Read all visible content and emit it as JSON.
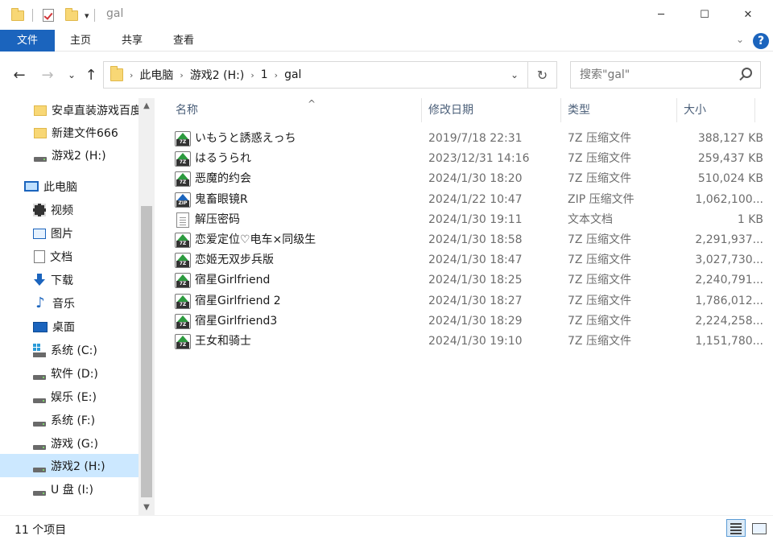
{
  "window": {
    "title": "gal",
    "minimize": "─",
    "maximize": "☐",
    "close": "✕"
  },
  "ribbon": {
    "tabs": [
      "文件",
      "主页",
      "共享",
      "查看"
    ],
    "help": "?",
    "collapse": "⌄"
  },
  "address": {
    "crumbs": [
      "此电脑",
      "游戏2 (H:)",
      "1",
      "gal"
    ],
    "separator": "›",
    "dropdown": "⌄",
    "refresh": "↻"
  },
  "nav_buttons": {
    "back": "←",
    "forward": "→",
    "recent": "⌄",
    "up": "↑"
  },
  "search": {
    "placeholder": "搜索\"gal\""
  },
  "nav_pane": {
    "items": [
      {
        "label": "安卓直装游戏百度",
        "icon": "folder-icon"
      },
      {
        "label": "新建文件666",
        "icon": "folder-icon"
      },
      {
        "label": "游戏2 (H:)",
        "icon": "drive-icon"
      },
      {
        "label": "此电脑",
        "icon": "pc-icon"
      },
      {
        "label": "视频",
        "icon": "video-icon"
      },
      {
        "label": "图片",
        "icon": "pictures-icon"
      },
      {
        "label": "文档",
        "icon": "documents-icon"
      },
      {
        "label": "下载",
        "icon": "downloads-icon"
      },
      {
        "label": "音乐",
        "icon": "music-icon"
      },
      {
        "label": "桌面",
        "icon": "desktop-icon"
      },
      {
        "label": "系统 (C:)",
        "icon": "system-drive-icon"
      },
      {
        "label": "软件 (D:)",
        "icon": "drive-icon"
      },
      {
        "label": "娱乐 (E:)",
        "icon": "drive-icon"
      },
      {
        "label": "系统 (F:)",
        "icon": "drive-icon"
      },
      {
        "label": "游戏 (G:)",
        "icon": "drive-icon"
      },
      {
        "label": "游戏2 (H:)",
        "icon": "drive-icon"
      },
      {
        "label": "U 盘 (I:)",
        "icon": "drive-icon"
      }
    ],
    "selected_index": 15
  },
  "columns": {
    "name": "名称",
    "date": "修改日期",
    "type": "类型",
    "size": "大小",
    "sort_indicator": "^"
  },
  "files": [
    {
      "name": "いもうと誘惑えっち",
      "date": "2019/7/18 22:31",
      "type": "7Z 压缩文件",
      "size": "388,127 KB",
      "icon": "7z"
    },
    {
      "name": "はるうられ",
      "date": "2023/12/31 14:16",
      "type": "7Z 压缩文件",
      "size": "259,437 KB",
      "icon": "7z"
    },
    {
      "name": "恶魔的约会",
      "date": "2024/1/30 18:20",
      "type": "7Z 压缩文件",
      "size": "510,024 KB",
      "icon": "7z"
    },
    {
      "name": "鬼畜眼镜R",
      "date": "2024/1/22 10:47",
      "type": "ZIP 压缩文件",
      "size": "1,062,100...",
      "icon": "zip"
    },
    {
      "name": "解压密码",
      "date": "2024/1/30 19:11",
      "type": "文本文档",
      "size": "1 KB",
      "icon": "txt"
    },
    {
      "name": "恋爱定位♡电车×同级生",
      "date": "2024/1/30 18:58",
      "type": "7Z 压缩文件",
      "size": "2,291,937...",
      "icon": "7z"
    },
    {
      "name": "恋姬无双步兵版",
      "date": "2024/1/30 18:47",
      "type": "7Z 压缩文件",
      "size": "3,027,730...",
      "icon": "7z"
    },
    {
      "name": "宿星Girlfriend",
      "date": "2024/1/30 18:25",
      "type": "7Z 压缩文件",
      "size": "2,240,791...",
      "icon": "7z"
    },
    {
      "name": "宿星Girlfriend 2",
      "date": "2024/1/30 18:27",
      "type": "7Z 压缩文件",
      "size": "1,786,012...",
      "icon": "7z"
    },
    {
      "name": "宿星Girlfriend3",
      "date": "2024/1/30 18:29",
      "type": "7Z 压缩文件",
      "size": "2,224,258...",
      "icon": "7z"
    },
    {
      "name": "王女和骑士",
      "date": "2024/1/30 19:10",
      "type": "7Z 压缩文件",
      "size": "1,151,780...",
      "icon": "7z"
    }
  ],
  "status": {
    "count": "11 个项目"
  },
  "colors": {
    "accent": "#1b64bd",
    "selected": "#cce8ff"
  }
}
